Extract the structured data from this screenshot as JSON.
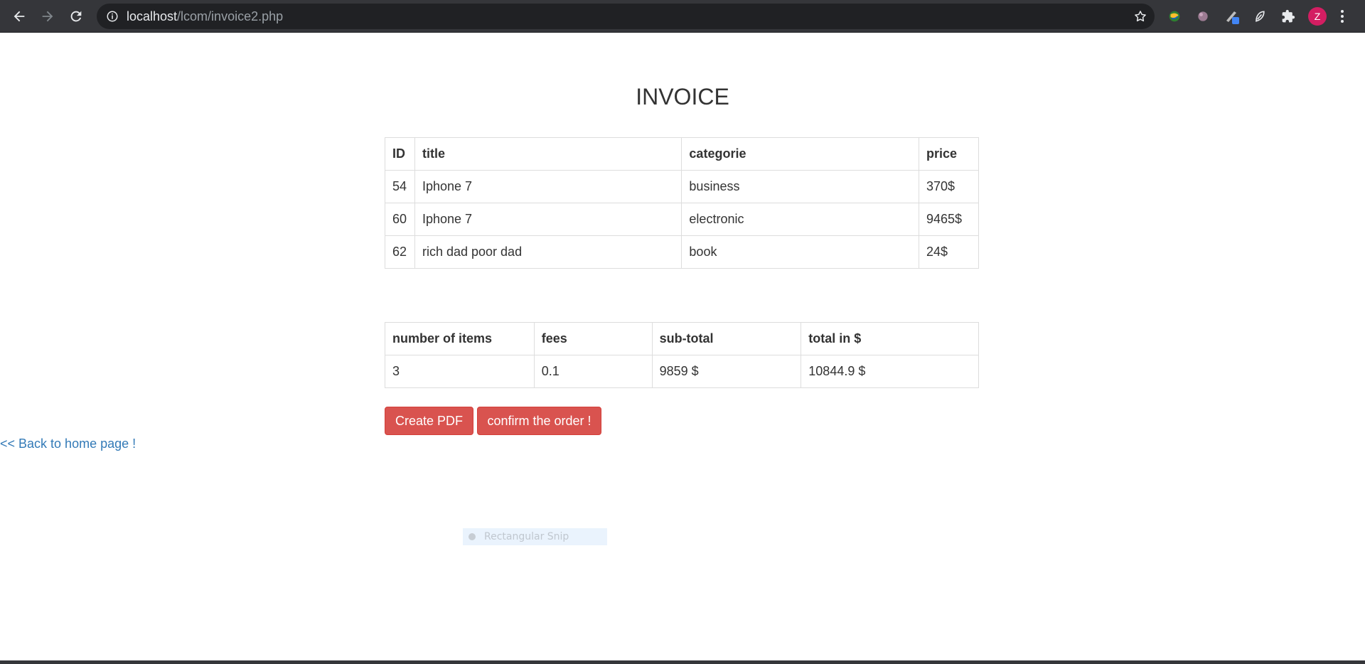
{
  "browser": {
    "url_host": "localhost",
    "url_path": "/lcom/invoice2.php",
    "profile_initial": "Z",
    "icons": [
      "back-arrow-icon",
      "forward-arrow-icon",
      "reload-icon",
      "info-icon",
      "bookmark-star-icon",
      "extension-globe-icon",
      "extension-ball-icon",
      "extension-pen-icon",
      "extension-leaf-icon",
      "puzzle-icon",
      "menu-dots-icon"
    ]
  },
  "page": {
    "title": "INVOICE",
    "items_table": {
      "headers": [
        "ID",
        "title",
        "categorie",
        "price"
      ],
      "rows": [
        [
          "54",
          "Iphone 7",
          "business",
          "370$"
        ],
        [
          "60",
          "Iphone 7",
          "electronic",
          "9465$"
        ],
        [
          "62",
          "rich dad poor dad",
          "book",
          "24$"
        ]
      ]
    },
    "summary_table": {
      "headers": [
        "number of items",
        "fees",
        "sub-total",
        "total in $"
      ],
      "rows": [
        [
          "3",
          "0.1",
          "9859 $",
          "10844.9 $"
        ]
      ]
    },
    "buttons": {
      "create_pdf": "Create PDF",
      "confirm_order": "confirm the order !"
    },
    "back_link": "<< Back to home page !",
    "snip_label": "Rectangular Snip"
  },
  "colors": {
    "button_red": "#d9534f",
    "link_blue": "#337ab7",
    "toolbar": "#35363a",
    "profile_pink": "#d31e62"
  }
}
